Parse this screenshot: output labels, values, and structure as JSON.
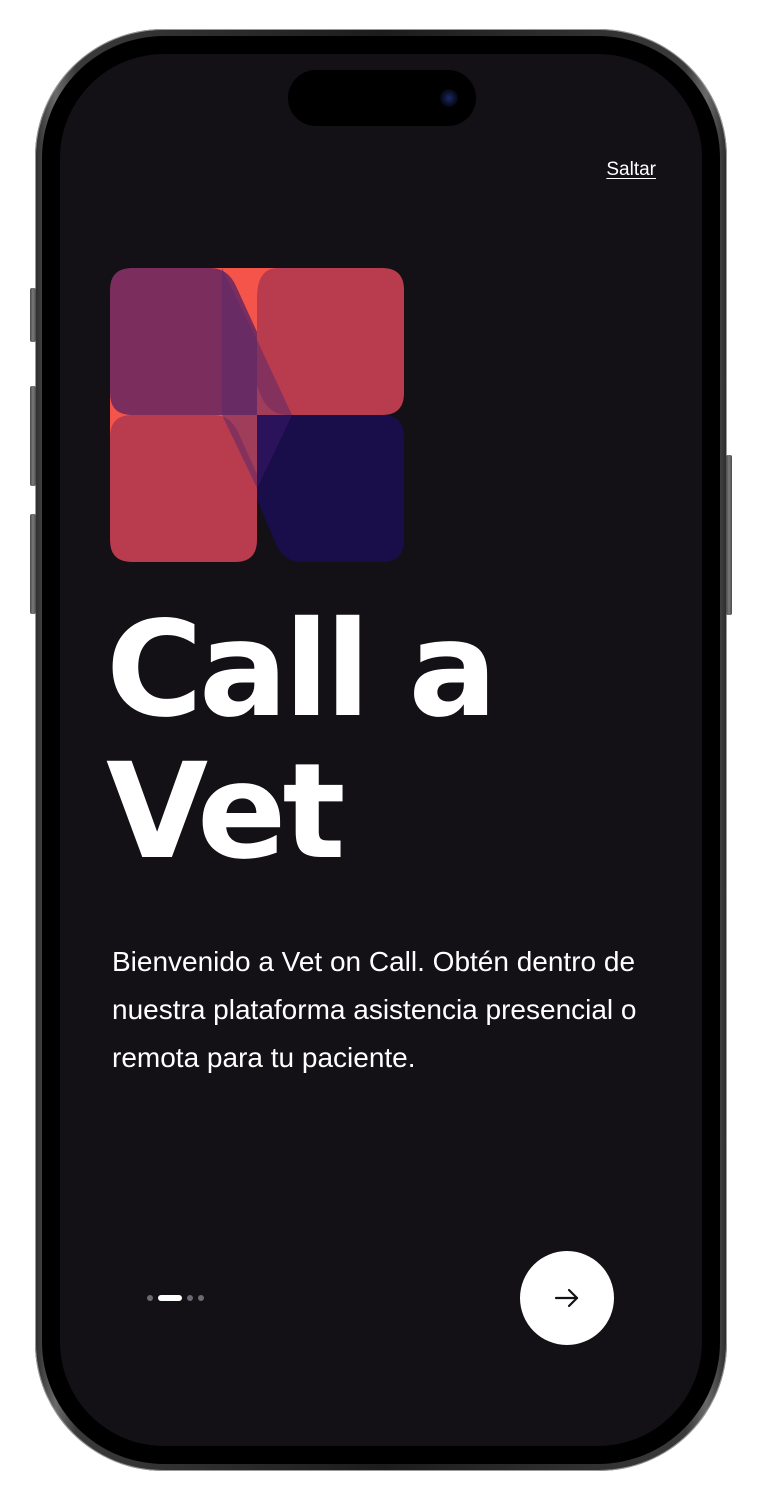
{
  "app": {
    "skip_label": "Saltar",
    "title_line1": "Call a",
    "title_line2": "Vet",
    "description": "Bienvenido a Vet on Call. Obtén dentro de nuestra plataforma asistencia presencial o remota para tu paciente."
  },
  "pager": {
    "total_pages": 4,
    "active_page": 2
  },
  "next_button": {
    "icon": "arrow-right-icon"
  },
  "colors": {
    "background": "#131016",
    "text": "#ffffff",
    "logo_coral": "#f5544a",
    "logo_plum": "#7b2e5e",
    "logo_rose": "#b83c4e",
    "logo_navy": "#1a0e4a",
    "button_bg": "#ffffff"
  }
}
